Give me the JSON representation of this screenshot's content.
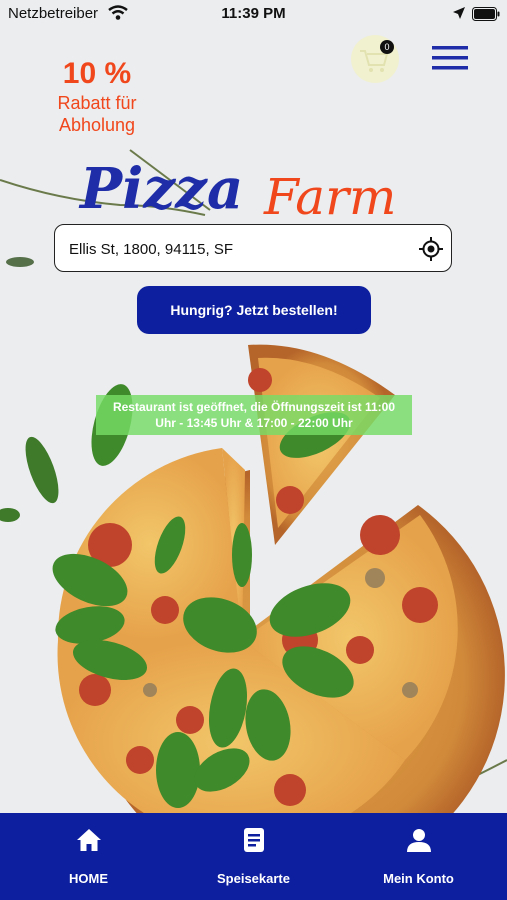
{
  "status_bar": {
    "carrier": "Netzbetreiber",
    "time": "11:39 PM"
  },
  "cart": {
    "count": "0"
  },
  "promo": {
    "percent": "10 %",
    "line1": "Rabatt für",
    "line2": "Abholung"
  },
  "logo": {
    "word1": "Pizza",
    "word2": "Farm",
    "color1": "#1f2ea8",
    "color2": "#f1471c"
  },
  "address": {
    "value": "Ellis St, 1800, 94115, SF"
  },
  "order_button": {
    "label": "Hungrig? Jetzt bestellen!"
  },
  "notice": {
    "line1": "Restaurant ist geöffnet, die Öffnungszeit ist 11:00",
    "line2": "Uhr - 13:45 Uhr & 17:00 - 22:00 Uhr"
  },
  "tabs": [
    {
      "label": "HOME",
      "icon": "home-icon"
    },
    {
      "label": "Speisekarte",
      "icon": "menu-card-icon"
    },
    {
      "label": "Mein Konto",
      "icon": "account-icon"
    }
  ],
  "colors": {
    "brand_blue": "#0d1f9e",
    "accent_orange": "#f1471c",
    "notice_green": "#76dc66"
  }
}
